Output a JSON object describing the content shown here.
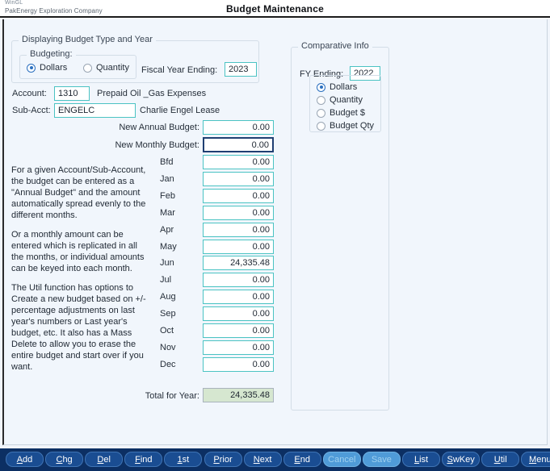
{
  "titlebar": {
    "app_name": "WinGL",
    "company": "PakEnergy Exploration Company",
    "window_title": "Budget Maintenance"
  },
  "display_group": {
    "legend": "Displaying Budget Type and Year",
    "budgeting_legend": "Budgeting:",
    "budgeting_options": [
      {
        "label": "Dollars",
        "selected": true
      },
      {
        "label": "Quantity",
        "selected": false
      }
    ],
    "fiscal_year_label": "Fiscal Year Ending:",
    "fiscal_year_value": "2023"
  },
  "account": {
    "account_label": "Account:",
    "account_value": "1310",
    "account_desc": "Prepaid Oil _Gas Expenses",
    "subacct_label": "Sub-Acct:",
    "subacct_value": "ENGELC",
    "subacct_desc": "Charlie Engel Lease"
  },
  "budget": {
    "new_annual_label": "New Annual Budget:",
    "new_annual_value": "0.00",
    "new_monthly_label": "New Monthly Budget:",
    "new_monthly_value": "0.00",
    "rows": [
      {
        "label": "Bfd",
        "value": "0.00"
      },
      {
        "label": "Jan",
        "value": "0.00"
      },
      {
        "label": "Feb",
        "value": "0.00"
      },
      {
        "label": "Mar",
        "value": "0.00"
      },
      {
        "label": "Apr",
        "value": "0.00"
      },
      {
        "label": "May",
        "value": "0.00"
      },
      {
        "label": "Jun",
        "value": "24,335.48"
      },
      {
        "label": "Jul",
        "value": "0.00"
      },
      {
        "label": "Aug",
        "value": "0.00"
      },
      {
        "label": "Sep",
        "value": "0.00"
      },
      {
        "label": "Oct",
        "value": "0.00"
      },
      {
        "label": "Nov",
        "value": "0.00"
      },
      {
        "label": "Dec",
        "value": "0.00"
      }
    ],
    "total_label": "Total for Year:",
    "total_value": "24,335.48"
  },
  "help": {
    "para1": "For a given Account/Sub-Account, the budget can be entered as a \"Annual Budget\" and the amount automatically spread evenly to the different months.",
    "para2": "Or a monthly amount can be entered which is replicated in all the months, or individual amounts can be keyed into each month.",
    "para3": "The Util function has options to Create a new budget based on +/- percentage adjustments on last year's numbers or Last year's budget, etc.  It also has a Mass Delete to allow you to erase the entire budget and start over if you want."
  },
  "comparative": {
    "legend": "Comparative Info",
    "fy_ending_label": "FY Ending:",
    "fy_ending_value": "2022",
    "options": [
      {
        "label": "Dollars",
        "selected": true
      },
      {
        "label": "Quantity",
        "selected": false
      },
      {
        "label": "Budget $",
        "selected": false
      },
      {
        "label": "Budget Qty",
        "selected": false
      }
    ]
  },
  "toolbar": {
    "buttons": [
      {
        "label": "Add",
        "accel": "A",
        "disabled": false
      },
      {
        "label": "Chg",
        "accel": "C",
        "disabled": false
      },
      {
        "label": "Del",
        "accel": "D",
        "disabled": false
      },
      {
        "label": "Find",
        "accel": "F",
        "disabled": false
      },
      {
        "label": "1st",
        "accel": "1",
        "disabled": false
      },
      {
        "label": "Prior",
        "accel": "P",
        "disabled": false
      },
      {
        "label": "Next",
        "accel": "N",
        "disabled": false
      },
      {
        "label": "End",
        "accel": "E",
        "disabled": false
      },
      {
        "label": "Cancel",
        "accel": "",
        "disabled": true
      },
      {
        "label": "Save",
        "accel": "",
        "disabled": true
      },
      {
        "label": "List",
        "accel": "L",
        "disabled": false
      },
      {
        "label": "SwKey",
        "accel": "S",
        "disabled": false
      },
      {
        "label": "Util",
        "accel": "U",
        "disabled": false
      },
      {
        "label": "Menu",
        "accel": "M",
        "disabled": false
      }
    ]
  },
  "colors": {
    "accent_teal": "#4bc3c3",
    "toolbar_bg": "#0c2f63",
    "button_bg": "#1a4d92",
    "total_bg": "#d6e7d0",
    "focus_border": "#1f3f72"
  }
}
